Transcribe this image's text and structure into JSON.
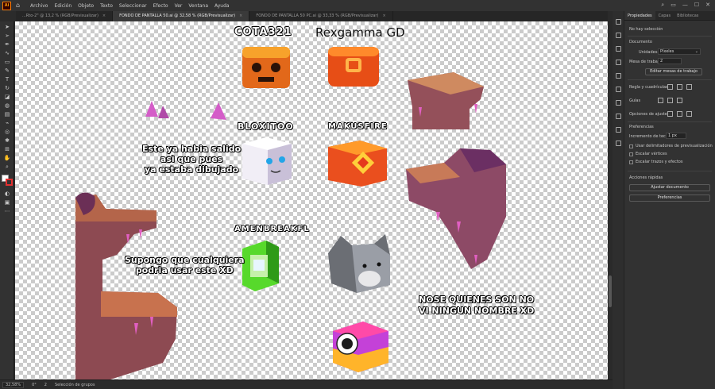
{
  "app": {
    "logo": "Ai",
    "menu": [
      "Archivo",
      "Edición",
      "Objeto",
      "Texto",
      "Seleccionar",
      "Efecto",
      "Ver",
      "Ventana",
      "Ayuda"
    ]
  },
  "tabs": [
    {
      "label": "...Rto-2\" @ 13,2 % (RGB/Previsualizar)",
      "active": false
    },
    {
      "label": "FONDO DE PANTALLA 50.ai @ 32,58 % (RGB/Previsualizar)",
      "active": true
    },
    {
      "label": "FONDO DE PANTALLA 50 PC.ai @ 33,33 % (RGB/Previsualizar)",
      "active": false
    }
  ],
  "panel": {
    "tabs": [
      "Propiedades",
      "Capas",
      "Bibliotecas"
    ],
    "no_selection": "No hay selección",
    "document_heading": "Documento",
    "units_label": "Unidades:",
    "units_value": "Píxeles",
    "artboard_label": "Mesa de trabajo:",
    "artboard_value": "2",
    "edit_artboards_button": "Editar mesas de trabajo",
    "grid_label": "Regla y cuadrículas",
    "guides_label": "Guías",
    "snap_label": "Opciones de ajuste",
    "preferences_heading": "Preferencias",
    "keyboard_increment_label": "Incremento de teclado:",
    "keyboard_increment_value": "1 px",
    "checkbox_preview_bounds": "Usar delimitadores de previsualización",
    "checkbox_scale_corners": "Escalar vértices",
    "checkbox_scale_strokes": "Escalar trazos y efectos",
    "quick_actions_heading": "Acciones rápidas",
    "fit_document_button": "Ajustar documento",
    "preferences_button": "Preferencias"
  },
  "status": {
    "zoom": "32,58%",
    "angle": "0°",
    "artboard": "2",
    "selection_tool": "Selección de grupos"
  },
  "canvas": {
    "names": {
      "cota": "COTA321",
      "rexgamma": "Rexgamma GD",
      "bloxitoo": "BLOXITOO",
      "makusfire": "MAKUSFIRE",
      "amenbreak": "AMENBREAKFL"
    },
    "notes": {
      "note1_line1": "Este ya habia salido",
      "note1_line2": "asi que pues",
      "note1_line3": "ya estaba dibujado",
      "note2_line1": "Supongo que cualquiera",
      "note2_line2": "podria usar este XD",
      "note3_line1": "NOSE QUIENES SON NO",
      "note3_line2": "VI NINGUN NOMBRE XD"
    }
  },
  "colors": {
    "canvas_checker": "#cbcbcb",
    "ui_dark": "#323232",
    "accent_orange": "#ff7c00"
  }
}
